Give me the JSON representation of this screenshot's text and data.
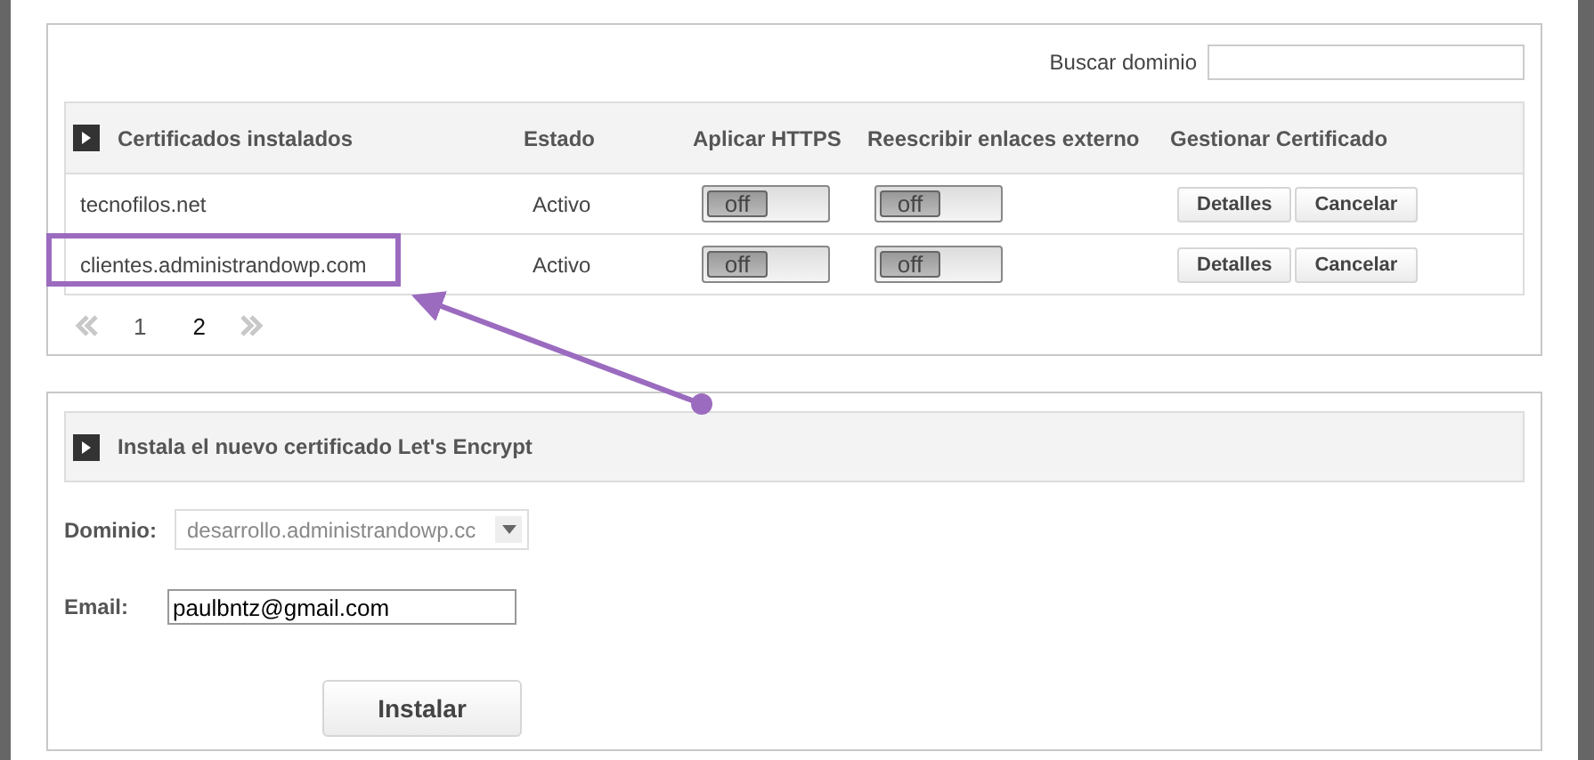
{
  "search": {
    "label": "Buscar dominio"
  },
  "certificates_table": {
    "columns": [
      "Certificados instalados",
      "Estado",
      "Aplicar HTTPS",
      "Reescribir enlaces externo",
      "Gestionar Certificado"
    ],
    "rows": [
      {
        "domain": "tecnofilos.net",
        "status": "Activo",
        "https": {
          "on": false,
          "label": "off"
        },
        "rewrite": {
          "on": false,
          "label": "off"
        },
        "actions": [
          "Detalles",
          "Cancelar"
        ]
      },
      {
        "domain": "clientes.administrandowp.com",
        "status": "Activo",
        "https": {
          "on": false,
          "label": "off"
        },
        "rewrite": {
          "on": false,
          "label": "off"
        },
        "actions": [
          "Detalles",
          "Cancelar"
        ]
      }
    ]
  },
  "pagination": {
    "prev_disabled": true,
    "next_disabled": true,
    "pages": [
      {
        "label": "1",
        "selected": false
      },
      {
        "label": "2",
        "selected": true
      }
    ]
  },
  "install_panel": {
    "title": "Instala el nuevo certificado Let's Encrypt",
    "domain_label": "Dominio:",
    "domain_value": "desarrollo.administrandowp.cc",
    "email_label": "Email:",
    "email_value": "paulbntz@gmail.com",
    "button": "Instalar"
  }
}
